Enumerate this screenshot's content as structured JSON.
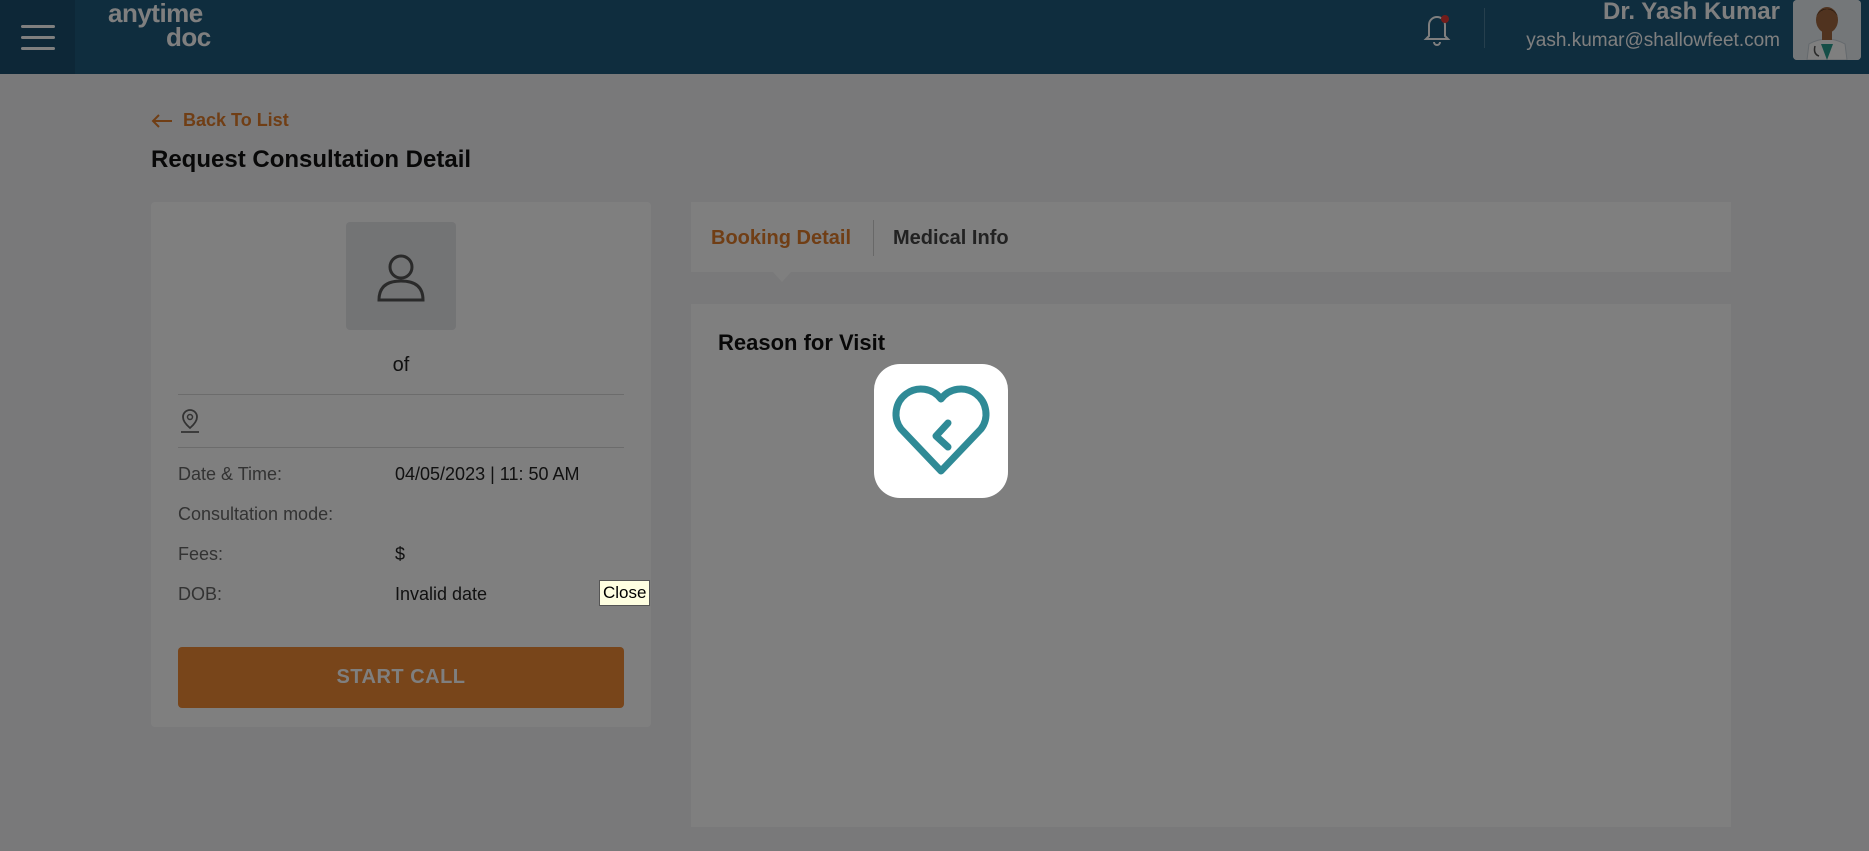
{
  "header": {
    "logo_top": "anytime",
    "logo_bottom": "doc",
    "doctor_name": "Dr. Yash Kumar",
    "doctor_email": "yash.kumar@shallowfeet.com"
  },
  "page": {
    "back_label": "Back To List",
    "title": "Request Consultation Detail"
  },
  "patient": {
    "name_line": "of",
    "rows": [
      {
        "label": "Date & Time:",
        "value": "04/05/2023 | 11: 50 AM"
      },
      {
        "label": "Consultation mode:",
        "value": ""
      },
      {
        "label": "Fees:",
        "value": "$"
      },
      {
        "label": "DOB:",
        "value": "Invalid date"
      }
    ],
    "start_call_label": "START CALL"
  },
  "tabs": [
    {
      "label": "Booking Detail",
      "active": true
    },
    {
      "label": "Medical Info",
      "active": false
    }
  ],
  "content": {
    "reason_heading": "Reason for Visit"
  },
  "tooltip": "Close",
  "colors": {
    "header_bg": "#1f5a7c",
    "accent": "#e07c2a",
    "button": "#f08a35",
    "loader_icon": "#2f8a96"
  }
}
